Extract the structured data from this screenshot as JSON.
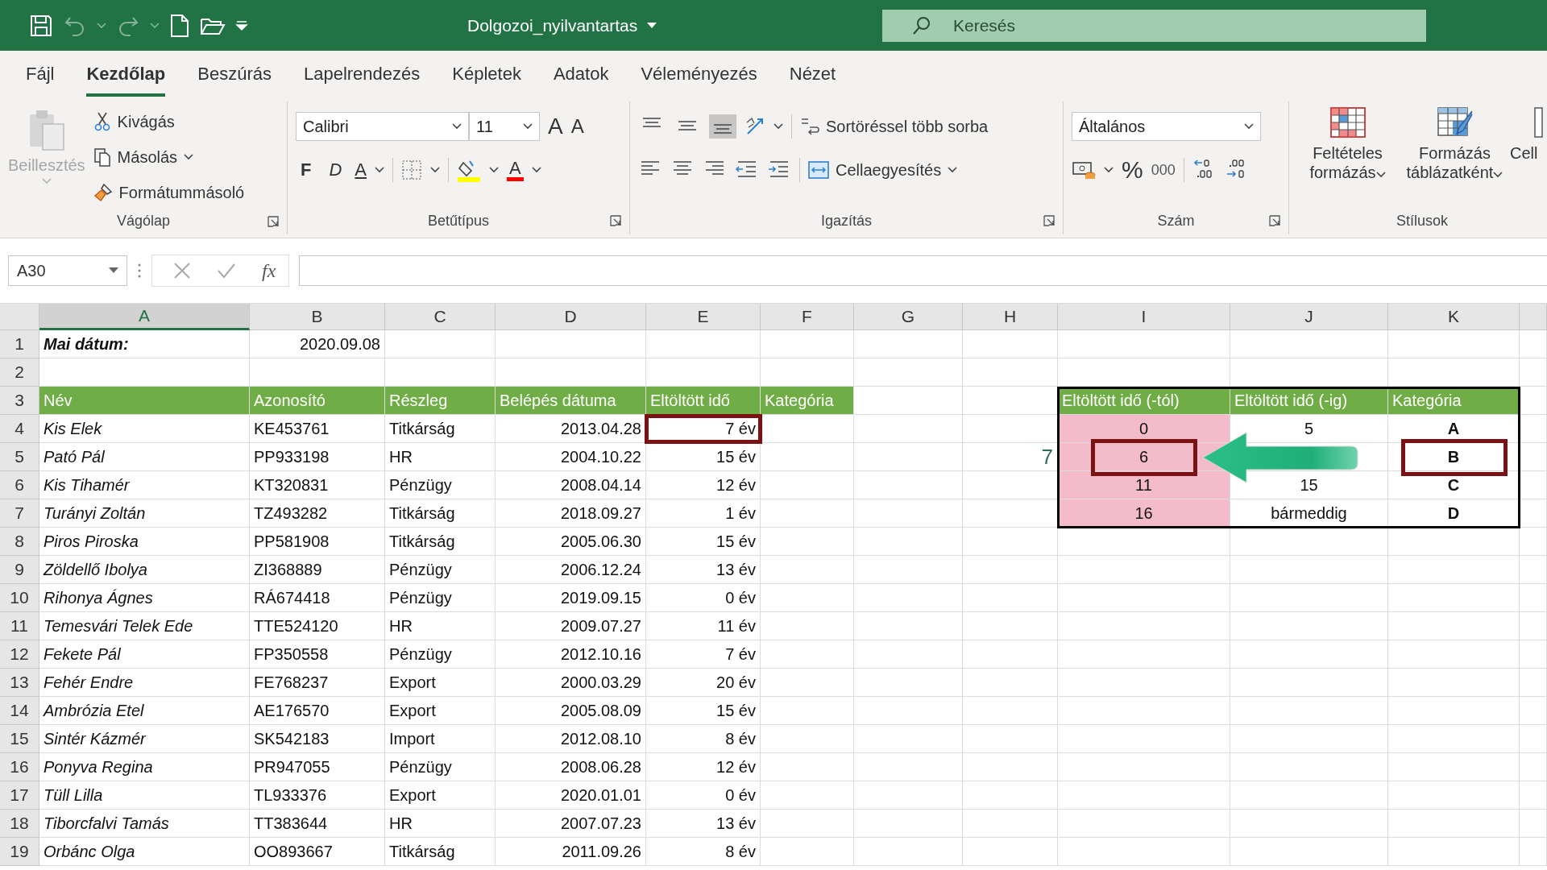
{
  "title_bar": {
    "undo_disabled": true,
    "redo_disabled": true,
    "file_name": "Dolgozoi_nyilvantartas",
    "search": {
      "placeholder": "Keresés"
    }
  },
  "tabs": [
    {
      "label": "Fájl",
      "selected": false
    },
    {
      "label": "Kezdőlap",
      "selected": true
    },
    {
      "label": "Beszúrás",
      "selected": false
    },
    {
      "label": "Lapelrendezés",
      "selected": false
    },
    {
      "label": "Képletek",
      "selected": false
    },
    {
      "label": "Adatok",
      "selected": false
    },
    {
      "label": "Véleményezés",
      "selected": false
    },
    {
      "label": "Nézet",
      "selected": false
    }
  ],
  "ribbon": {
    "clipboard": {
      "label": "Vágólap",
      "paste": "Beillesztés",
      "paste_disabled": true,
      "cut": "Kivágás",
      "copy": "Másolás",
      "format_painter": "Formátummásoló"
    },
    "font": {
      "label": "Betűtípus",
      "font_name": "Calibri",
      "font_size": "11",
      "grow": "A",
      "shrink": "A",
      "bold": "F",
      "italic": "D",
      "underline": "A",
      "font_color": "A"
    },
    "alignment": {
      "label": "Igazítás",
      "vertical_buttons": [
        {
          "selected": false
        },
        {
          "selected": false
        },
        {
          "selected": true
        }
      ],
      "wrap_text": "Sortöréssel több sorba",
      "merge": "Cellaegyesítés"
    },
    "number": {
      "label": "Szám",
      "format": "Általános",
      "percent": "%",
      "thousands": "000"
    },
    "styles": {
      "label": "Stílusok",
      "conditional": "Feltételes formázás",
      "format_table": "Formázás táblázatként",
      "cell_styles": "Cell"
    }
  },
  "formula_bar": {
    "name_box": "A30",
    "fx": "fx"
  },
  "sheet": {
    "columns": [
      {
        "label": "A",
        "selected": true
      },
      {
        "label": "B",
        "selected": false
      },
      {
        "label": "C",
        "selected": false
      },
      {
        "label": "D",
        "selected": false
      },
      {
        "label": "E",
        "selected": false
      },
      {
        "label": "F",
        "selected": false
      },
      {
        "label": "G",
        "selected": false
      },
      {
        "label": "H",
        "selected": false
      },
      {
        "label": "I",
        "selected": false
      },
      {
        "label": "J",
        "selected": false
      },
      {
        "label": "K",
        "selected": false
      }
    ],
    "rows": [
      "1",
      "2",
      "3",
      "4",
      "5",
      "6",
      "7",
      "8",
      "9",
      "10",
      "11",
      "12",
      "13",
      "14",
      "15",
      "16",
      "17",
      "18",
      "19"
    ],
    "today_label": "Mai dátum:",
    "today_value": "2020.09.08",
    "headers": [
      "Név",
      "Azonosító",
      "Részleg",
      "Belépés dátuma",
      "Eltöltött idő",
      "Kategória"
    ],
    "employees": [
      {
        "name": "Kis Elek",
        "id": "KE453761",
        "department": "Titkárság",
        "entry_date": "2013.04.28",
        "elapsed": "7 év",
        "highlighted": true
      },
      {
        "name": "Pató Pál",
        "id": "PP933198",
        "department": "HR",
        "entry_date": "2004.10.22",
        "elapsed": "15 év",
        "highlighted": false
      },
      {
        "name": "Kis Tihamér",
        "id": "KT320831",
        "department": "Pénzügy",
        "entry_date": "2008.04.14",
        "elapsed": "12 év",
        "highlighted": false
      },
      {
        "name": "Turányi Zoltán",
        "id": "TZ493282",
        "department": "Titkárság",
        "entry_date": "2018.09.27",
        "elapsed": "1 év",
        "highlighted": false
      },
      {
        "name": "Piros Piroska",
        "id": "PP581908",
        "department": "Titkárság",
        "entry_date": "2005.06.30",
        "elapsed": "15 év",
        "highlighted": false
      },
      {
        "name": "Zöldellő Ibolya",
        "id": "ZI368889",
        "department": "Pénzügy",
        "entry_date": "2006.12.24",
        "elapsed": "13 év",
        "highlighted": false
      },
      {
        "name": "Rihonya Ágnes",
        "id": "RÁ674418",
        "department": "Pénzügy",
        "entry_date": "2019.09.15",
        "elapsed": "0 év",
        "highlighted": false
      },
      {
        "name": "Temesvári Telek Ede",
        "id": "TTE524120",
        "department": "HR",
        "entry_date": "2009.07.27",
        "elapsed": "11 év",
        "highlighted": false
      },
      {
        "name": "Fekete Pál",
        "id": "FP350558",
        "department": "Pénzügy",
        "entry_date": "2012.10.16",
        "elapsed": "7 év",
        "highlighted": false
      },
      {
        "name": "Fehér Endre",
        "id": "FE768237",
        "department": "Export",
        "entry_date": "2000.03.29",
        "elapsed": "20 év",
        "highlighted": false
      },
      {
        "name": "Ambrózia Etel",
        "id": "AE176570",
        "department": "Export",
        "entry_date": "2005.08.09",
        "elapsed": "15 év",
        "highlighted": false
      },
      {
        "name": "Sintér Kázmér",
        "id": "SK542183",
        "department": "Import",
        "entry_date": "2012.08.10",
        "elapsed": "8 év",
        "highlighted": false
      },
      {
        "name": "Ponyva Regina",
        "id": "PR947055",
        "department": "Pénzügy",
        "entry_date": "2008.06.28",
        "elapsed": "12 év",
        "highlighted": false
      },
      {
        "name": "Tüll Lilla",
        "id": "TL933376",
        "department": "Export",
        "entry_date": "2020.01.01",
        "elapsed": "0 év",
        "highlighted": false
      },
      {
        "name": "Tiborcfalvi Tamás",
        "id": "TT383644",
        "department": "HR",
        "entry_date": "2007.07.23",
        "elapsed": "13 év",
        "highlighted": false
      },
      {
        "name": "Orbánc Olga",
        "id": "OO893667",
        "department": "Titkárság",
        "entry_date": "2011.09.26",
        "elapsed": "8 év",
        "highlighted": false
      }
    ],
    "lookup_value": "7",
    "lookup_table": {
      "headers": [
        "Eltöltött idő (-tól)",
        "Eltöltött idő (-ig)",
        "Kategória"
      ],
      "rows": [
        {
          "from": "0",
          "to": "5",
          "category": "A",
          "highlighted": false
        },
        {
          "from": "6",
          "category": "B",
          "highlighted": true
        },
        {
          "from": "11",
          "to": "15",
          "category": "C",
          "highlighted": false
        },
        {
          "from": "16",
          "to": "bármeddig",
          "category": "D",
          "highlighted": false
        }
      ]
    }
  }
}
